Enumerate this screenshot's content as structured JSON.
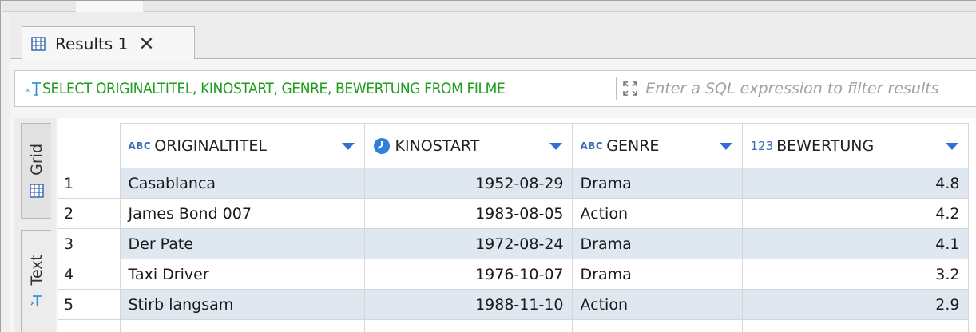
{
  "tab": {
    "label": "Results 1",
    "close": "✕"
  },
  "filter": {
    "query": "SELECT ORIGINALTITEL, KINOSTART, GENRE, BEWERTUNG FROM FILME",
    "placeholder": "Enter a SQL expression to filter results"
  },
  "side_tabs": {
    "grid": "Grid",
    "text": "Text"
  },
  "columns": [
    {
      "type_badge": "ABC",
      "name": "ORIGINALTITEL"
    },
    {
      "type_badge": "clock-icon",
      "name": "KINOSTART"
    },
    {
      "type_badge": "ABC",
      "name": "GENRE"
    },
    {
      "type_badge": "123",
      "name": "BEWERTUNG"
    }
  ],
  "rows": [
    {
      "num": "1",
      "title": "Casablanca",
      "date": "1952-08-29",
      "genre": "Drama",
      "rating": "4.8"
    },
    {
      "num": "2",
      "title": "James Bond 007",
      "date": "1983-08-05",
      "genre": "Action",
      "rating": "4.2"
    },
    {
      "num": "3",
      "title": "Der Pate",
      "date": "1972-08-24",
      "genre": "Drama",
      "rating": "4.1"
    },
    {
      "num": "4",
      "title": "Taxi Driver",
      "date": "1976-10-07",
      "genre": "Drama",
      "rating": "3.2"
    },
    {
      "num": "5",
      "title": "Stirb langsam",
      "date": "1988-11-10",
      "genre": "Action",
      "rating": "2.9"
    }
  ],
  "colors": {
    "sql_text": "#1f9e1f",
    "row_stripe": "#dfe7f1",
    "type_badge": "#3b6cb3"
  }
}
